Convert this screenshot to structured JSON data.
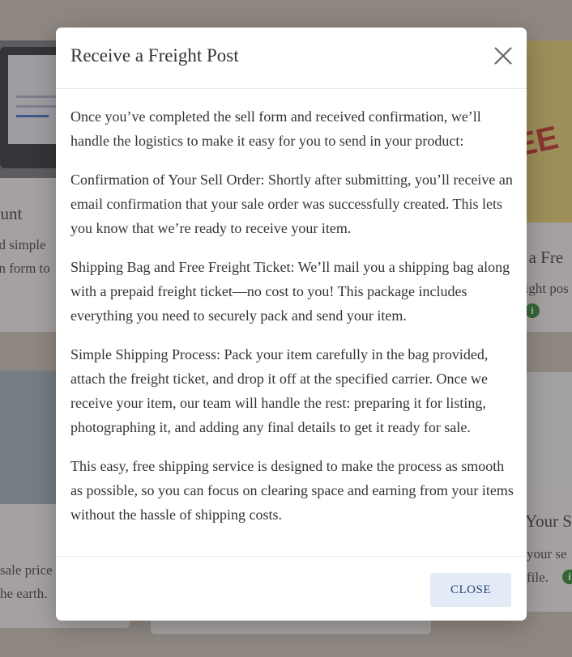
{
  "modal": {
    "title": "Receive a Freight Post",
    "paragraphs": [
      "Once you’ve completed the sell form and received confirmation, we’ll handle the logistics to make it easy for you to send in your product:",
      "Confirmation of Your Sell Order: Shortly after submitting, you’ll receive an email confirmation that your sale order was successfully created. This lets you know that we’re ready to receive your item.",
      "Shipping Bag and Free Freight Ticket: We’ll mail you a shipping bag along with a prepaid freight ticket—no cost to you! This package includes everything you need to securely pack and send your item.",
      "Simple Shipping Process: Pack your item carefully in the bag provided, attach the freight ticket, and drop it off at the specified carrier. Once we receive your item, our team will handle the rest: preparing it for listing, photographing it, and adding any final details to get it ready for sale.",
      "This easy, free shipping service is designed to make the process as smooth as possible, so you can focus on clearing space and earning from your items without the hassle of shipping costs."
    ],
    "close_label": "CLOSE"
  },
  "background": {
    "left_top_title": "ount",
    "left_top_text": [
      "nd simple",
      "on form to"
    ],
    "right_top_title": "e a Fre",
    "right_top_text": "eight pos",
    "right_top_stamp": "EE",
    "left_bottom_text": [
      "sale price",
      "he earth."
    ],
    "right_bottom_title": "Your S",
    "right_bottom_text": [
      "your se",
      "file."
    ],
    "info_glyph": "i"
  },
  "colors": {
    "accent_button_bg": "#e3ebf6",
    "accent_button_text": "#27467a",
    "info_green": "#2e7d32"
  }
}
